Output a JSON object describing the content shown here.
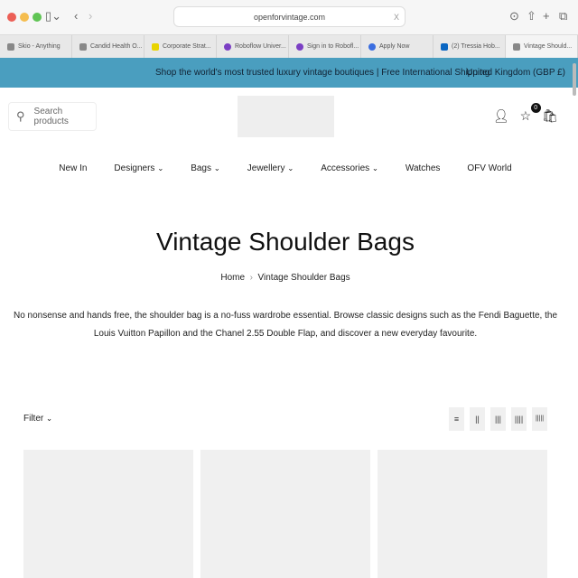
{
  "browser": {
    "url": "openforvintage.com",
    "tabs": [
      "Skio - Anything",
      "Candid Health O...",
      "Corporate Strat...",
      "Roboflow Univer...",
      "Sign in to Robofl...",
      "Apply Now",
      "(2) Tressia Hob...",
      "Vintage Should..."
    ]
  },
  "banner": {
    "message": "Shop the world's most trusted luxury vintage boutiques | Free International Shipping",
    "currency": "United Kingdom (GBP £)"
  },
  "header": {
    "search_placeholder": "Search products",
    "wishlist_count": "0"
  },
  "nav": [
    "New In",
    "Designers",
    "Bags",
    "Jewellery",
    "Accessories",
    "Watches",
    "OFV World"
  ],
  "page": {
    "title": "Vintage Shoulder Bags",
    "breadcrumb": [
      "Home",
      "Vintage Shoulder Bags"
    ],
    "description": "No nonsense and hands free, the shoulder bag is a no-fuss wardrobe essential. Browse classic designs such as the Fendi Baguette, the Louis Vuitton Papillon and the Chanel 2.55 Double Flap, and discover a new everyday favourite."
  },
  "toolbar": {
    "filter": "Filter",
    "views": [
      "≡",
      "||",
      "|||",
      "||||",
      "|||||"
    ]
  },
  "colors": {
    "banner": "#4a9ebf"
  }
}
